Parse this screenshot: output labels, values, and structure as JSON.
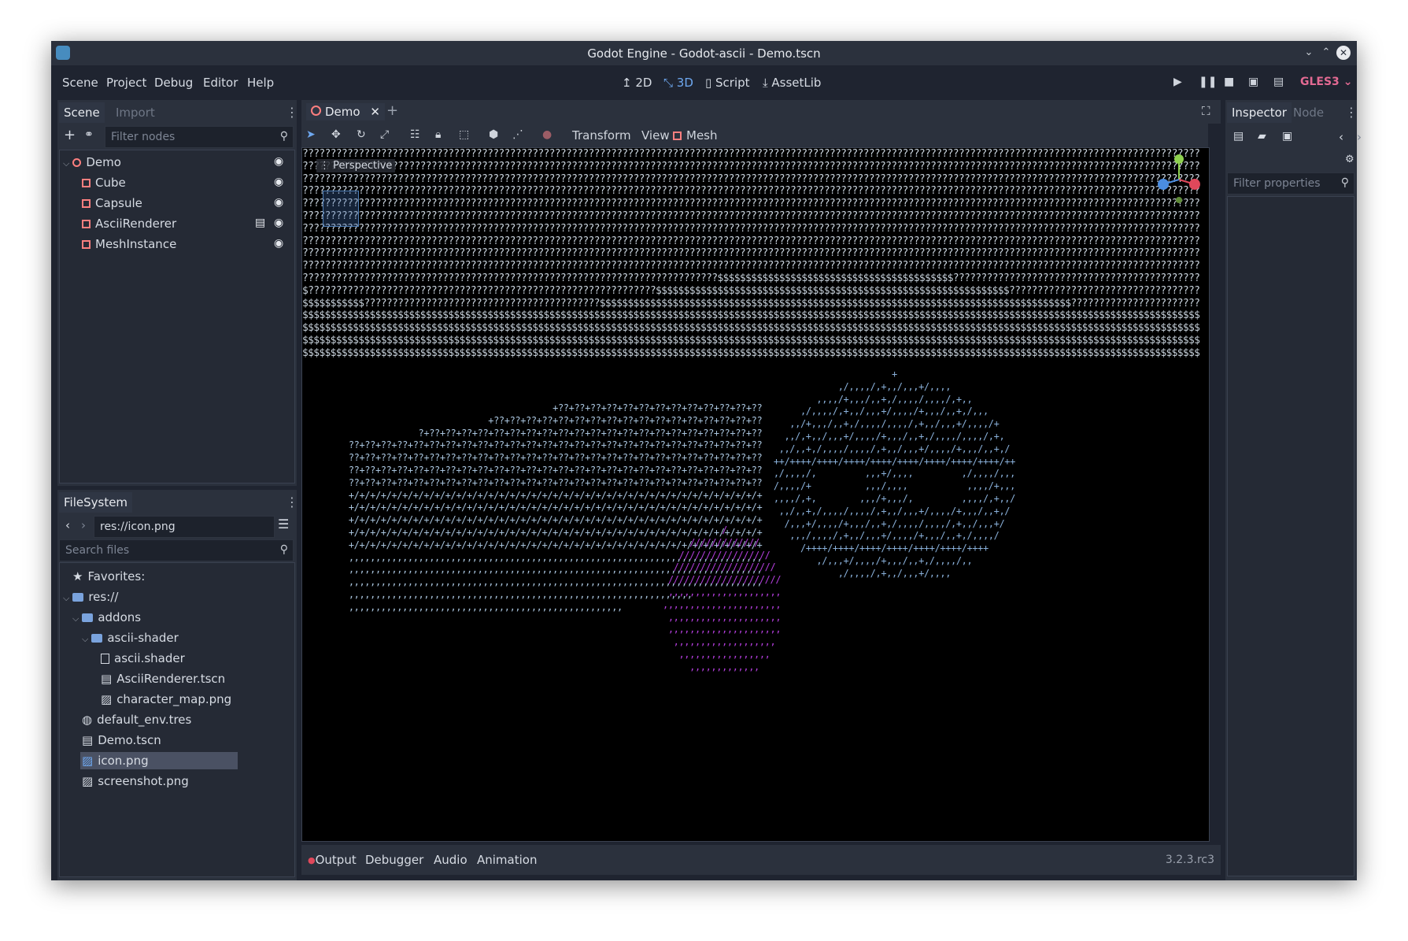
{
  "window": {
    "title": "Godot Engine - Godot-ascii - Demo.tscn"
  },
  "menu": [
    "Scene",
    "Project",
    "Debug",
    "Editor",
    "Help"
  ],
  "workspaces": [
    {
      "label": "2D",
      "icon": "2d-icon"
    },
    {
      "label": "3D",
      "icon": "3d-icon"
    },
    {
      "label": "Script",
      "icon": "script-icon"
    },
    {
      "label": "AssetLib",
      "icon": "assetlib-icon"
    }
  ],
  "renderer": "GLES3",
  "scene_dock": {
    "tabs": [
      "Scene",
      "Import"
    ],
    "filter_placeholder": "Filter nodes",
    "nodes": [
      {
        "name": "Demo",
        "icon": "spatial-node-icon"
      },
      {
        "name": "Cube",
        "icon": "mesh-instance-icon"
      },
      {
        "name": "Capsule",
        "icon": "mesh-instance-icon"
      },
      {
        "name": "AsciiRenderer",
        "icon": "mesh-instance-icon"
      },
      {
        "name": "MeshInstance",
        "icon": "mesh-instance-icon"
      }
    ]
  },
  "filesystem": {
    "tab": "FileSystem",
    "path": "res://icon.png",
    "search_placeholder": "Search files",
    "favorites": "Favorites:",
    "items": [
      {
        "label": "res://",
        "kind": "folder"
      },
      {
        "label": "addons",
        "kind": "folder"
      },
      {
        "label": "ascii-shader",
        "kind": "folder"
      },
      {
        "label": "ascii.shader",
        "kind": "file"
      },
      {
        "label": "AsciiRenderer.tscn",
        "kind": "scene"
      },
      {
        "label": "character_map.png",
        "kind": "image"
      },
      {
        "label": "default_env.tres",
        "kind": "resource"
      },
      {
        "label": "Demo.tscn",
        "kind": "scene"
      },
      {
        "label": "icon.png",
        "kind": "image",
        "selected": true
      },
      {
        "label": "screenshot.png",
        "kind": "image"
      }
    ]
  },
  "editor_tab": "Demo",
  "viewport_toolbar": {
    "menus": [
      "Transform",
      "View",
      "Mesh"
    ]
  },
  "viewport": {
    "label": "Perspective"
  },
  "bottom_panel": {
    "tabs": [
      "Output",
      "Debugger",
      "Audio",
      "Animation"
    ],
    "version": "3.2.3.rc3"
  },
  "inspector": {
    "tabs": [
      "Inspector",
      "Node"
    ],
    "filter_placeholder": "Filter properties"
  },
  "colors": {
    "accent": "#6ea8f0",
    "gles": "#e36a93",
    "node_icon": "#fc7f7f"
  }
}
